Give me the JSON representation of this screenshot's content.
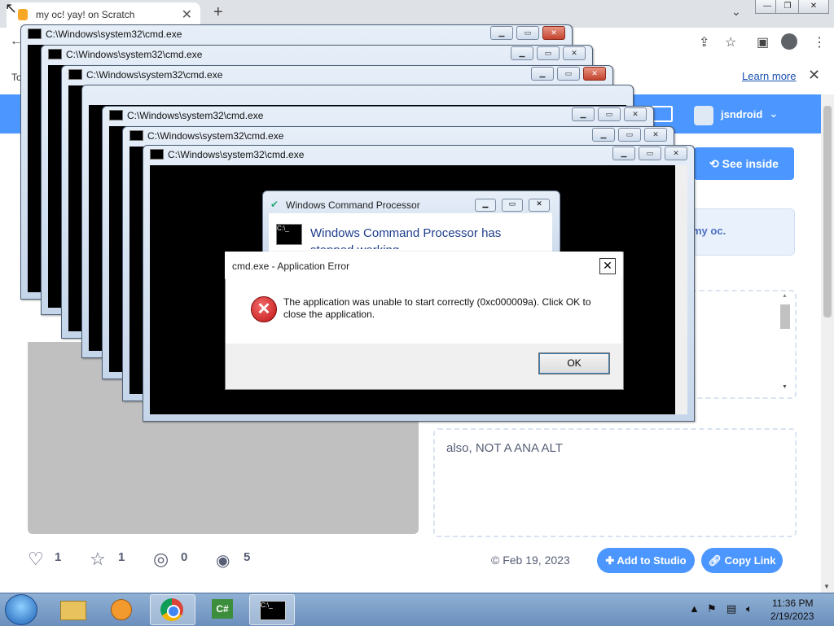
{
  "browser": {
    "tab_title": "my oc! yay! on Scratch",
    "tab_close": "✕",
    "new_tab": "+",
    "infobar_left": "To",
    "learn_more": "Learn more",
    "infobar_close": "✕"
  },
  "scratch": {
    "username": "jsndroid",
    "see_inside": "See inside",
    "description_fragment": "my oc.",
    "credits_text": "also, NOT A ANA ALT",
    "stats": {
      "loves": "1",
      "favorites": "1",
      "remixes": "0",
      "views": "5"
    },
    "date": "Feb 19, 2023",
    "add_to_studio": "Add to Studio",
    "copy_link": "Copy Link"
  },
  "cmd_windows": [
    {
      "title": "C:\\Windows\\system32\\cmd.exe"
    },
    {
      "title": "C:\\Windows\\system32\\cmd.exe"
    },
    {
      "title": "C:\\Windows\\system32\\cmd.exe"
    },
    {
      "title": "C:\\Windows\\system32\\cmd.exe"
    },
    {
      "title": "C:\\Windows\\system32\\cmd.exe"
    },
    {
      "title": "C:\\Windows\\system32\\cmd.exe"
    }
  ],
  "wcp_dialog": {
    "title": "Windows Command Processor",
    "heading": "Windows Command Processor has stopped working"
  },
  "error_dialog": {
    "title": "cmd.exe - Application Error",
    "message": "The application was unable to start correctly (0xc000009a). Click OK to close the application.",
    "ok": "OK"
  },
  "taskbar": {
    "time": "11:36 PM",
    "date": "2/19/2023"
  },
  "colors": {
    "scratch_blue": "#4c97ff",
    "error_red": "#c21313"
  }
}
